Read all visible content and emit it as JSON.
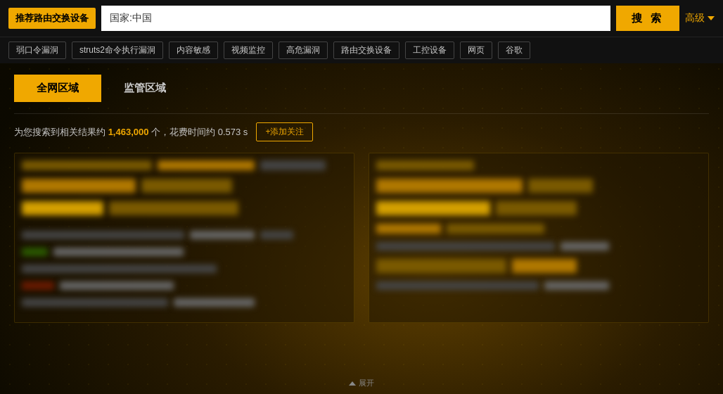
{
  "topbar": {
    "recommend_label": "推荐路由交换设备",
    "search_value": "国家:中国",
    "search_btn": "搜 索",
    "advanced_label": "高级"
  },
  "tags": [
    "弱口令漏洞",
    "struts2命令执行漏洞",
    "内容敏感",
    "视频监控",
    "高危漏洞",
    "路由交换设备",
    "工控设备",
    "网页",
    "谷歌"
  ],
  "tabs": [
    {
      "label": "全网区域",
      "active": true
    },
    {
      "label": "监管区域",
      "active": false
    }
  ],
  "results": {
    "summary_prefix": "为您搜索到相关结果约",
    "count": "1,463,000",
    "summary_suffix": "个，花费时间约",
    "time": "0.573 s",
    "add_follow": "+添加关注"
  },
  "bottom": {
    "hint": "展开"
  }
}
